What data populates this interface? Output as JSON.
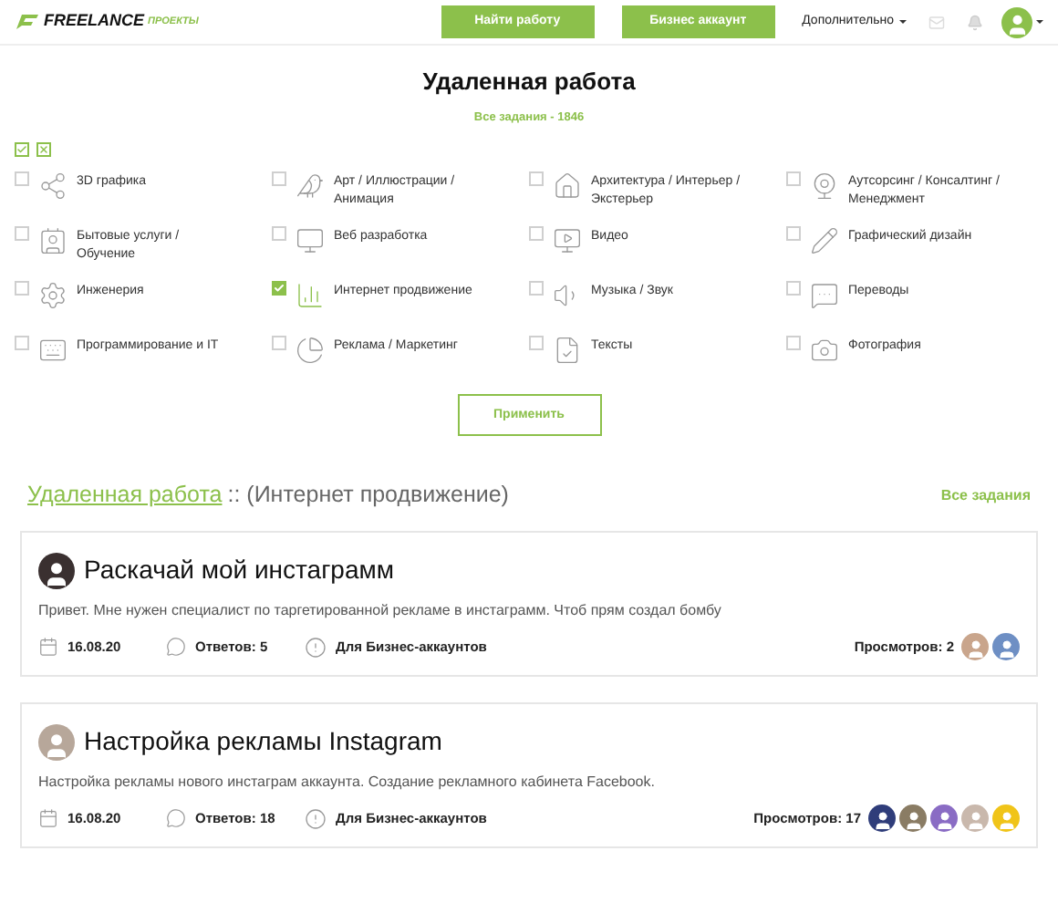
{
  "header": {
    "logo_main": "FREELANCE",
    "logo_sub": "ПРОЕКТЫ",
    "buttons": [
      "Найти работу",
      "Бизнес аккаунт"
    ],
    "more_menu": "Дополнительно"
  },
  "page": {
    "title": "Удаленная работа",
    "subtitle": "Все задания - 1846"
  },
  "bulk": {
    "select_all": true,
    "clear_all": false
  },
  "categories": [
    {
      "label": "3D графика",
      "kind": "share",
      "checked": false
    },
    {
      "label": "Арт / Иллюстрации / Анимация",
      "kind": "bird",
      "checked": false
    },
    {
      "label": "Архитектура / Интерьер / Экстерьер",
      "kind": "house",
      "checked": false
    },
    {
      "label": "Аутсорсинг / Консалтинг / Менеджмент",
      "kind": "webcam",
      "checked": false
    },
    {
      "label": "Бытовые услуги / Обучение",
      "kind": "contact",
      "checked": false
    },
    {
      "label": "Веб разработка",
      "kind": "monitor",
      "checked": false
    },
    {
      "label": "Видео",
      "kind": "video",
      "checked": false
    },
    {
      "label": "Графический дизайн",
      "kind": "pencil",
      "checked": false
    },
    {
      "label": "Инженерия",
      "kind": "gear",
      "checked": false
    },
    {
      "label": "Интернет продвижение",
      "kind": "chart",
      "checked": true
    },
    {
      "label": "Музыка / Звук",
      "kind": "speaker",
      "checked": false
    },
    {
      "label": "Переводы",
      "kind": "message",
      "checked": false
    },
    {
      "label": "Программирование и IT",
      "kind": "keyboard",
      "checked": false
    },
    {
      "label": "Реклама / Маркетинг",
      "kind": "pie",
      "checked": false
    },
    {
      "label": "Тексты",
      "kind": "document",
      "checked": false
    },
    {
      "label": "Фотография",
      "kind": "camera",
      "checked": false
    }
  ],
  "apply_button": "Применить",
  "section": {
    "link": "Удаленная работа",
    "rest": ":: (Интернет продвижение)",
    "all_link": "Все задания"
  },
  "tasks": [
    {
      "title": "Раскачай мой инстаграмм",
      "description": "Привет. Мне нужен специалист по таргетированной рекламе в инстаграмм. Чтоб прям создал бомбу",
      "date": "16.08.20",
      "replies": "Ответов: 5",
      "audience": "Для Бизнес-аккаунтов",
      "views": "Просмотров: 2",
      "author": {
        "color": "#3a3030"
      },
      "viewers": [
        {
          "color": "#c9a58c"
        },
        {
          "color": "#6e8fc4"
        }
      ]
    },
    {
      "title": "Настройка рекламы Instagram",
      "description": "Настройка рекламы нового инстаграм аккаунта. Создание рекламного кабинета Facebook.",
      "date": "16.08.20",
      "replies": "Ответов: 18",
      "audience": "Для Бизнес-аккаунтов",
      "views": "Просмотров: 17",
      "author": {
        "color": "#b7a79a"
      },
      "viewers": [
        {
          "color": "#2f3d7a"
        },
        {
          "color": "#8a7c64"
        },
        {
          "color": "#8a6cc4"
        },
        {
          "color": "#c9b8ac"
        },
        {
          "color": "#f0c419"
        }
      ]
    }
  ]
}
